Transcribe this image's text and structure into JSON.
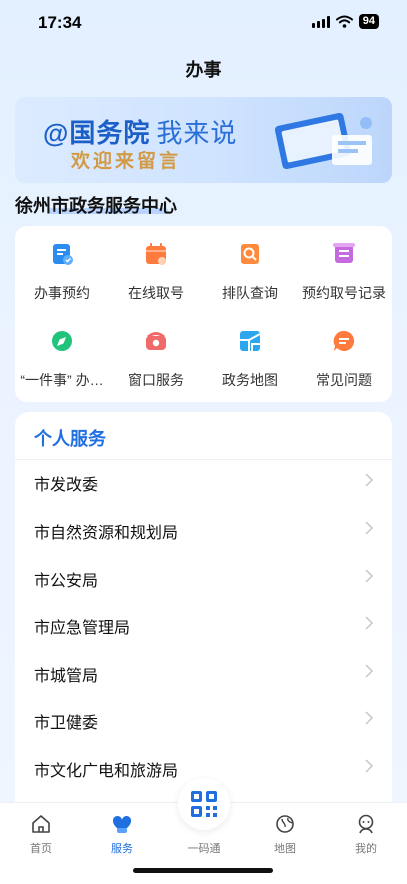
{
  "status": {
    "time": "17:34",
    "battery": "94"
  },
  "nav": {
    "title": "办事"
  },
  "banner": {
    "line1_main": "@国务院",
    "line1_sub": "我来说",
    "line2": "欢迎来留言"
  },
  "center": {
    "title": "徐州市政务服务中心"
  },
  "services": [
    {
      "label": "办事预约",
      "icon": "calendar-check-icon",
      "color": "#2d8cf0"
    },
    {
      "label": "在线取号",
      "icon": "calendar-icon",
      "color": "#ff7a3d"
    },
    {
      "label": "排队查询",
      "icon": "search-doc-icon",
      "color": "#ff8a3d"
    },
    {
      "label": "预约取号记录",
      "icon": "record-icon",
      "color": "#c46be0"
    },
    {
      "label": "“一件事” 办…",
      "icon": "compass-icon",
      "color": "#21c47a"
    },
    {
      "label": "窗口服务",
      "icon": "phone-icon",
      "color": "#f06a6a"
    },
    {
      "label": "政务地图",
      "icon": "map-icon",
      "color": "#2da6f0"
    },
    {
      "label": "常见问题",
      "icon": "chat-icon",
      "color": "#ff7a3d"
    }
  ],
  "personal": {
    "title": "个人服务",
    "departments": [
      "市发改委",
      "市自然资源和规划局",
      "市公安局",
      "市应急管理局",
      "市城管局",
      "市卫健委",
      "市文化广电和旅游局"
    ]
  },
  "tabs": [
    {
      "label": "首页",
      "icon": "home-icon"
    },
    {
      "label": "服务",
      "icon": "service-heart-icon",
      "active": true
    },
    {
      "label": "一码通",
      "icon": "qr-code-icon"
    },
    {
      "label": "地图",
      "icon": "map-pin-icon"
    },
    {
      "label": "我的",
      "icon": "profile-icon"
    }
  ]
}
